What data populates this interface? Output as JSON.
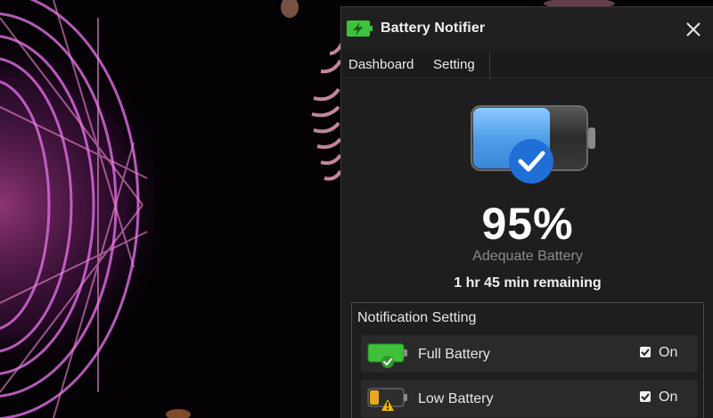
{
  "window": {
    "title": "Battery Notifier",
    "app_icon": "battery-notifier-app-icon",
    "close_icon": "close-icon"
  },
  "menu": {
    "tabs": [
      {
        "label": "Dashboard"
      },
      {
        "label": "Setting"
      }
    ]
  },
  "dashboard": {
    "battery_icon": "battery-full-check-icon",
    "percent_text": "95%",
    "percent_value": 95,
    "status": "Adequate Battery",
    "remaining": "1 hr 45 min remaining"
  },
  "notification_setting": {
    "title": "Notification Setting",
    "rows": [
      {
        "label": "Full Battery",
        "toggle_label": "On",
        "checked": true,
        "icon": "full-battery-icon"
      },
      {
        "label": "Low Battery",
        "toggle_label": "On",
        "checked": true,
        "icon": "low-battery-warning-icon"
      }
    ]
  },
  "colors": {
    "accent_blue": "#1f6fd6",
    "battery_blue": "#5aa8ee",
    "battery_green": "#3fbf3a",
    "warning_yellow": "#f2b705",
    "window_bg": "#1e1e1e"
  }
}
